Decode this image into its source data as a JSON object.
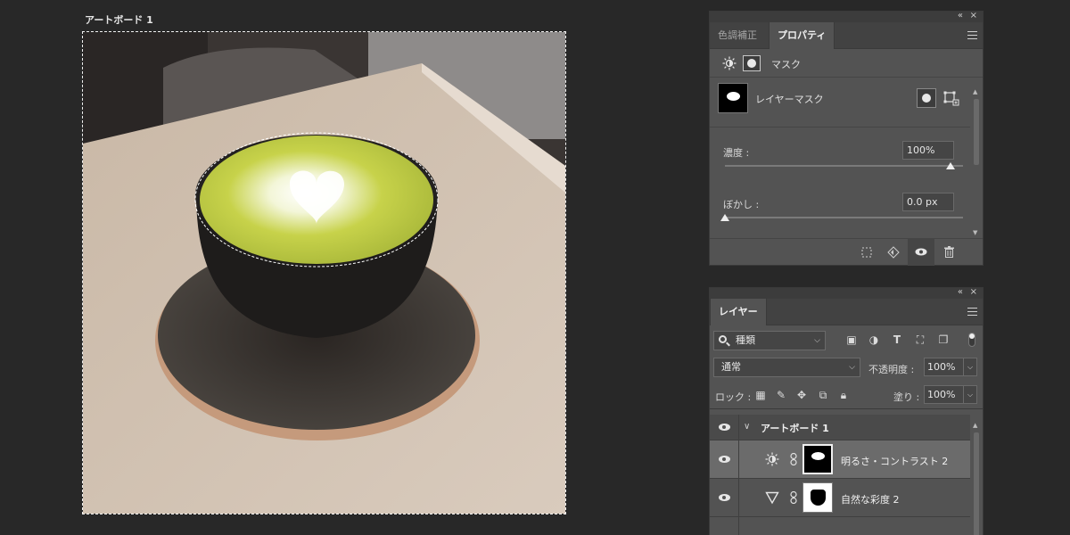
{
  "artboard": {
    "label": "アートボード 1"
  },
  "properties_panel": {
    "tabs": [
      {
        "label": "色調補正",
        "active": false
      },
      {
        "label": "プロパティ",
        "active": true
      }
    ],
    "collapse_glyph": "«",
    "close_glyph": "×",
    "header_label": "マスク",
    "mask_row_label": "レイヤーマスク",
    "density": {
      "label": "濃度 :",
      "value": "100%",
      "level": 1.0
    },
    "feather": {
      "label": "ぼかし :",
      "value": "0.0 px",
      "level": 0.0
    }
  },
  "layers_panel": {
    "tab_label": "レイヤー",
    "collapse_glyph": "«",
    "close_glyph": "×",
    "filter": {
      "kind_label": "種類"
    },
    "blend_mode": "通常",
    "opacity": {
      "label": "不透明度 :",
      "value": "100%"
    },
    "lock": {
      "label": "ロック :"
    },
    "fill": {
      "label": "塗り :",
      "value": "100%"
    },
    "layers": [
      {
        "name": "アートボード 1",
        "type": "group",
        "visible": true
      },
      {
        "name": "明るさ・コントラスト 2",
        "type": "adjustment",
        "adjust_icon": "brightness-contrast-icon",
        "visible": true,
        "selected": true
      },
      {
        "name": "自然な彩度 2",
        "type": "adjustment",
        "adjust_icon": "vibrance-icon",
        "visible": true,
        "selected": false
      }
    ]
  },
  "colors": {
    "background": "#282828",
    "panel": "#535353",
    "selected_layer": "#6b6b6b",
    "matcha": "#c4d34a"
  }
}
